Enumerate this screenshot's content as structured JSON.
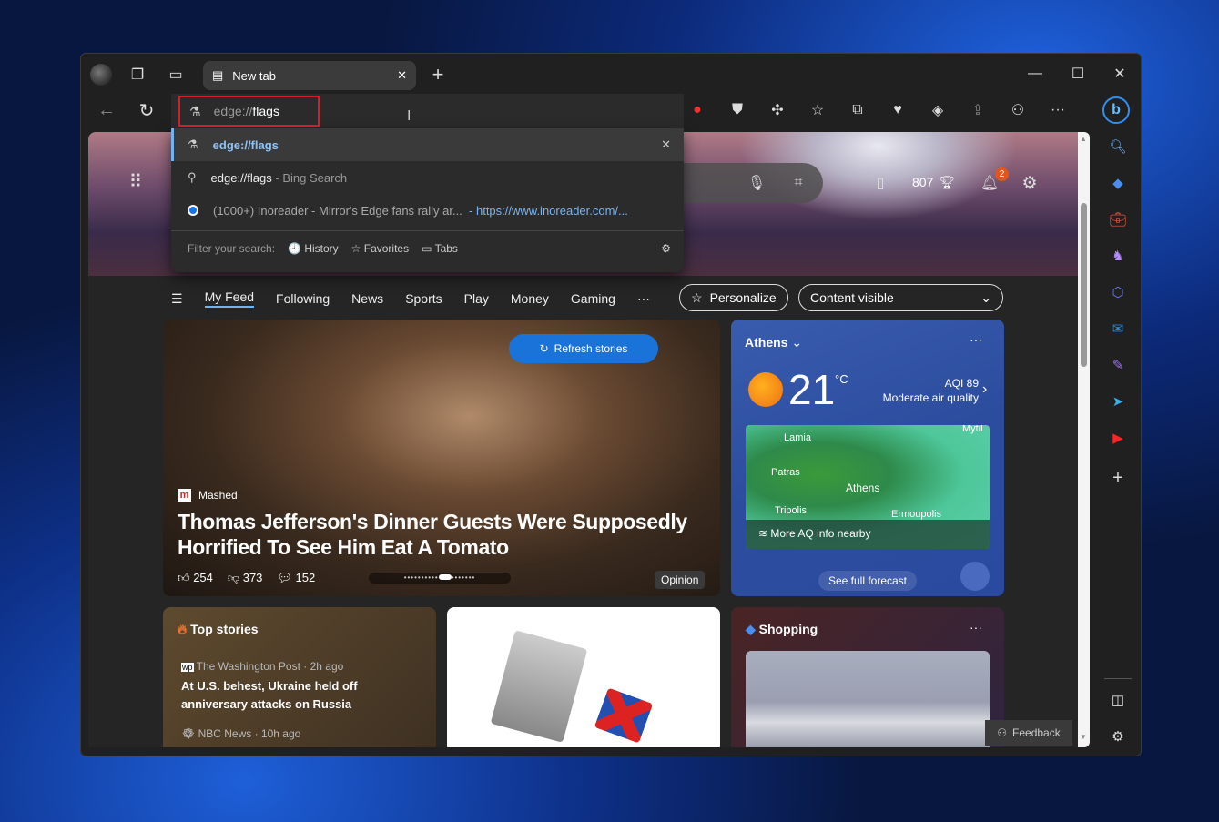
{
  "tab": {
    "title": "New tab"
  },
  "address": {
    "prefix": "edge://",
    "value": "flags"
  },
  "dropdown": {
    "items": [
      {
        "text": "edge://flags"
      },
      {
        "text": "edge://flags",
        "suffix": "- Bing Search"
      },
      {
        "text": "(1000+) Inoreader - Mirror's Edge fans rally ar...",
        "url": "- https://www.inoreader.com/..."
      }
    ],
    "filter_label": "Filter your search:",
    "filters": [
      "History",
      "Favorites",
      "Tabs"
    ]
  },
  "header": {
    "points": "807",
    "notifications": "2"
  },
  "nav": {
    "items": [
      "My Feed",
      "Following",
      "News",
      "Sports",
      "Play",
      "Money",
      "Gaming"
    ],
    "more": "···",
    "personalize": "Personalize",
    "content_select": "Content visible"
  },
  "hero_story": {
    "refresh": "Refresh stories",
    "source": "Mashed",
    "title": "Thomas Jefferson's Dinner Guests Were Supposedly Horrified To See Him Eat A Tomato",
    "likes": "254",
    "dislikes": "373",
    "comments": "152",
    "tag": "Opinion"
  },
  "weather": {
    "city": "Athens",
    "temp": "21",
    "unit": "°C",
    "aqi": "AQI 89",
    "aqi_desc": "Moderate air quality",
    "map_labels": [
      "Lamia",
      "Patras",
      "Athens",
      "Tripolis",
      "Ermoupolis",
      "Mytil"
    ],
    "aq_more": "More AQ info nearby",
    "forecast": "See full forecast",
    "more": "···"
  },
  "top_stories": {
    "title": "Top stories",
    "items": [
      {
        "source": "The Washington Post · 2h ago",
        "headline": "At U.S. behest, Ukraine held off anniversary attacks on Russia"
      },
      {
        "source": "NBC News · 10h ago"
      }
    ]
  },
  "shopping": {
    "title": "Shopping",
    "more": "···"
  },
  "feedback": "Feedback"
}
